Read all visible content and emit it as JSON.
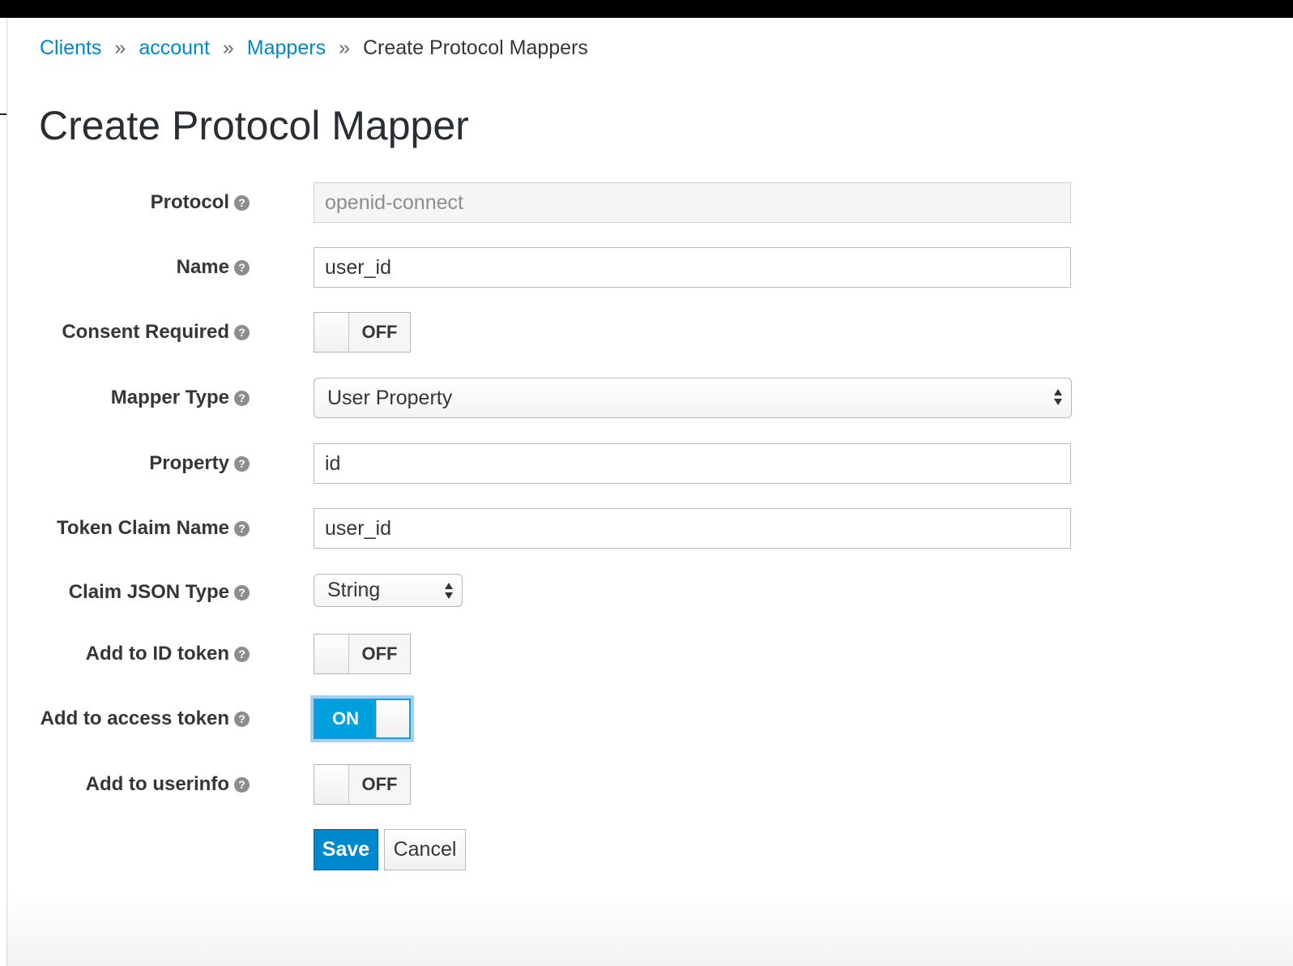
{
  "breadcrumb": {
    "items": [
      "Clients",
      "account",
      "Mappers"
    ],
    "separator": "»",
    "current": "Create Protocol Mappers"
  },
  "page_title": "Create Protocol Mapper",
  "help_glyph": "?",
  "form": {
    "protocol": {
      "label": "Protocol",
      "value": "openid-connect"
    },
    "name": {
      "label": "Name",
      "value": "user_id"
    },
    "consent_required": {
      "label": "Consent Required",
      "state": "OFF"
    },
    "mapper_type": {
      "label": "Mapper Type",
      "value": "User Property"
    },
    "property": {
      "label": "Property",
      "value": "id"
    },
    "token_claim_name": {
      "label": "Token Claim Name",
      "value": "user_id"
    },
    "claim_json_type": {
      "label": "Claim JSON Type",
      "value": "String"
    },
    "add_to_id_token": {
      "label": "Add to ID token",
      "state": "OFF"
    },
    "add_to_access_token": {
      "label": "Add to access token",
      "state": "ON"
    },
    "add_to_userinfo": {
      "label": "Add to userinfo",
      "state": "OFF"
    }
  },
  "buttons": {
    "save": "Save",
    "cancel": "Cancel"
  },
  "colors": {
    "link": "#0088ce",
    "primary": "#0088ce",
    "toggle_on": "#00a0df"
  },
  "icons": {
    "help": "question-circle-icon",
    "select": "up-down-arrows-icon"
  }
}
